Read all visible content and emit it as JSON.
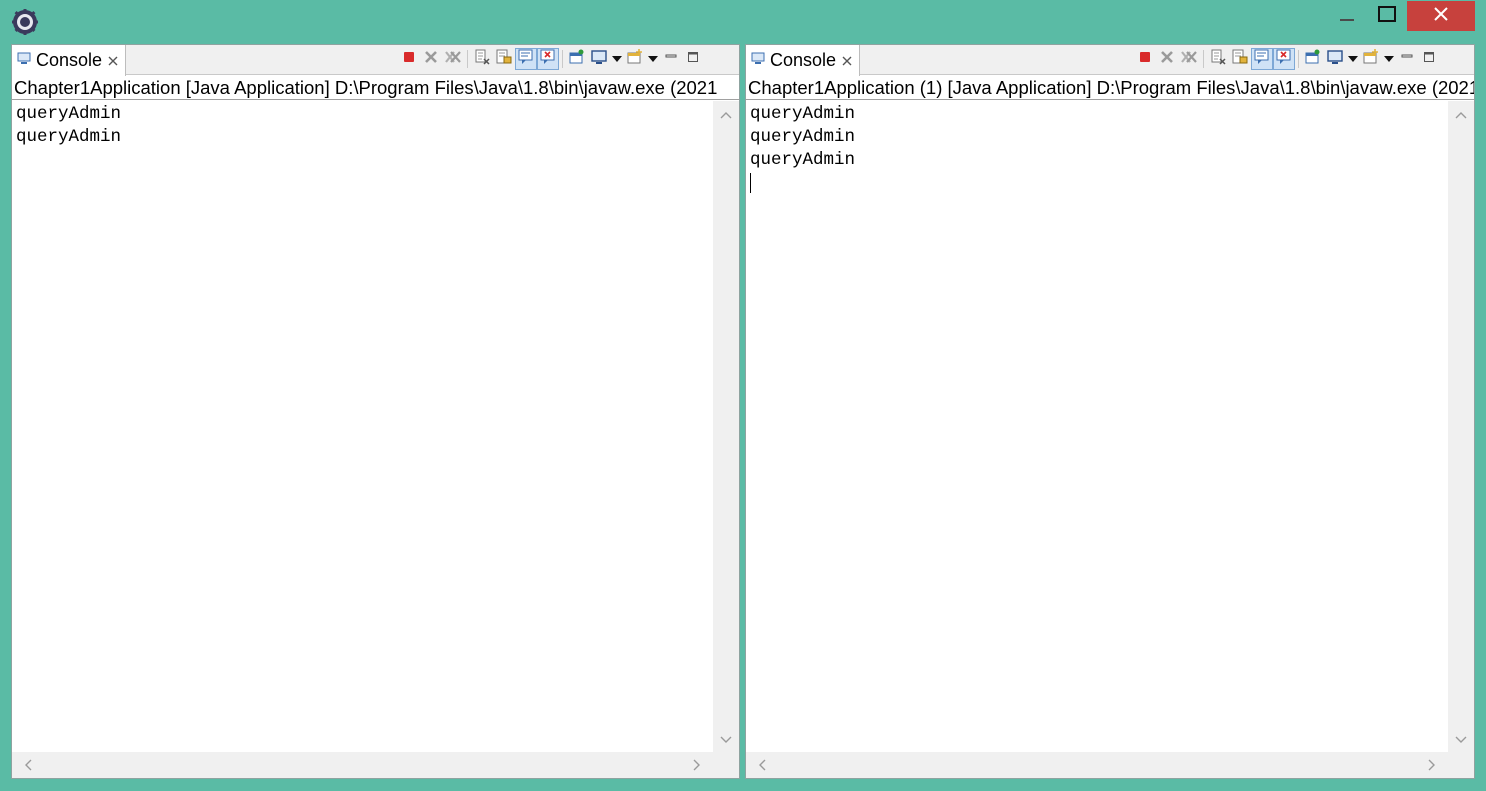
{
  "window": {
    "colors": {
      "frame": "#5abba5",
      "close": "#c7413d"
    },
    "icons": {
      "app": "eclipse-icon",
      "minimize": "minimize-icon",
      "maximize": "maximize-icon",
      "close": "close-icon"
    }
  },
  "left_panel": {
    "tab_label": "Console",
    "description": "Chapter1Application [Java Application] D:\\Program Files\\Java\\1.8\\bin\\javaw.exe (2021",
    "lines": [
      "queryAdmin",
      "queryAdmin"
    ]
  },
  "right_panel": {
    "tab_label": "Console",
    "description": "Chapter1Application (1) [Java Application] D:\\Program Files\\Java\\1.8\\bin\\javaw.exe (2021",
    "lines": [
      "queryAdmin",
      "queryAdmin",
      "queryAdmin"
    ]
  },
  "toolbar_icons": [
    "terminate-icon",
    "remove-launch-icon",
    "remove-all-launches-icon",
    "clear-console-icon",
    "scroll-lock-icon",
    "show-on-stdout-icon",
    "show-on-stderr-icon",
    "pin-console-icon",
    "display-console-icon",
    "open-console-icon",
    "minimize-view-icon",
    "maximize-view-icon"
  ]
}
